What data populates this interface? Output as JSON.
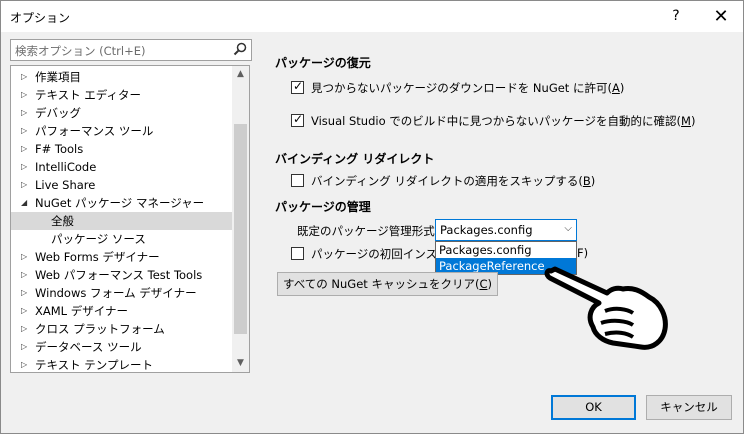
{
  "window": {
    "title": "オプション",
    "help": "?",
    "close": "✕"
  },
  "search": {
    "placeholder": "検索オプション (Ctrl+E)"
  },
  "tree": {
    "items": [
      {
        "arrow": "▷",
        "label": "作業項目"
      },
      {
        "arrow": "▷",
        "label": "テキスト エディター"
      },
      {
        "arrow": "▷",
        "label": "デバッグ"
      },
      {
        "arrow": "▷",
        "label": "パフォーマンス ツール"
      },
      {
        "arrow": "▷",
        "label": "F# Tools"
      },
      {
        "arrow": "▷",
        "label": "IntelliCode"
      },
      {
        "arrow": "▷",
        "label": "Live Share"
      },
      {
        "arrow": "◢",
        "label": "NuGet パッケージ マネージャー"
      },
      {
        "arrow": "",
        "label": "全般",
        "selected": true
      },
      {
        "arrow": "",
        "label": "パッケージ ソース"
      },
      {
        "arrow": "▷",
        "label": "Web Forms デザイナー"
      },
      {
        "arrow": "▷",
        "label": "Web パフォーマンス Test Tools"
      },
      {
        "arrow": "▷",
        "label": "Windows フォーム デザイナー"
      },
      {
        "arrow": "▷",
        "label": "XAML デザイナー"
      },
      {
        "arrow": "▷",
        "label": "クロス プラットフォーム"
      },
      {
        "arrow": "▷",
        "label": "データベース ツール"
      },
      {
        "arrow": "▷",
        "label": "テキスト テンプレート"
      }
    ]
  },
  "restore": {
    "heading": "パッケージの復元",
    "allow_download": {
      "text": "見つからないパッケージのダウンロードを NuGet に許可(",
      "key": "A",
      "end": ")",
      "checked": true
    },
    "auto_check": {
      "text": "Visual Studio でのビルド中に見つからないパッケージを自動的に確認(",
      "key": "M",
      "end": ")",
      "checked": true
    }
  },
  "binding": {
    "heading": "バインディング リダイレクト",
    "skip": {
      "text": "バインディング リダイレクトの適用をスキップする(",
      "key": "B",
      "end": ")",
      "checked": false
    }
  },
  "management": {
    "heading": "パッケージの管理",
    "format_label": "既定のパッケージ管理形式:",
    "format_value": "Packages.config",
    "options": [
      "Packages.config",
      "PackageReference"
    ],
    "first_install": {
      "text": "パッケージの初回インストール",
      "tail": "F)",
      "checked": false
    },
    "clear_cache": {
      "text": "すべての NuGet キャッシュをクリア(",
      "key": "C",
      "end": ")"
    }
  },
  "footer": {
    "ok": "OK",
    "cancel": "キャンセル"
  }
}
